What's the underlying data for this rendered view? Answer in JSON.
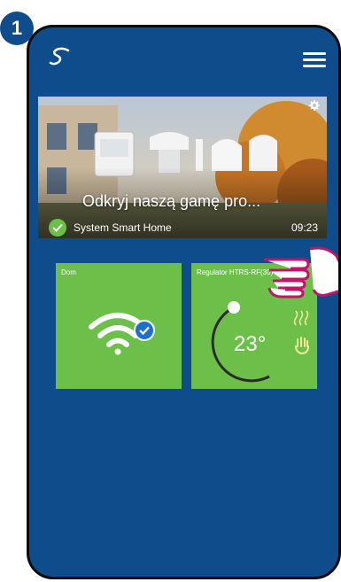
{
  "step": {
    "number": "1"
  },
  "banner": {
    "title": "Odkryj naszą gamę pro...",
    "status_label": "System Smart Home",
    "time": "09:23"
  },
  "devices": [
    {
      "title": "Dom",
      "icon": "wifi-icon",
      "badge_icon": "check-badge-icon"
    },
    {
      "title": "Regulator HTRS-RF(30)",
      "temperature": "23°",
      "icons": [
        "heating-icon",
        "hand-icon"
      ]
    }
  ],
  "colors": {
    "background": "#0f4c8c",
    "tile": "#6cc04a",
    "accent_badge": "#1e6fd0"
  }
}
